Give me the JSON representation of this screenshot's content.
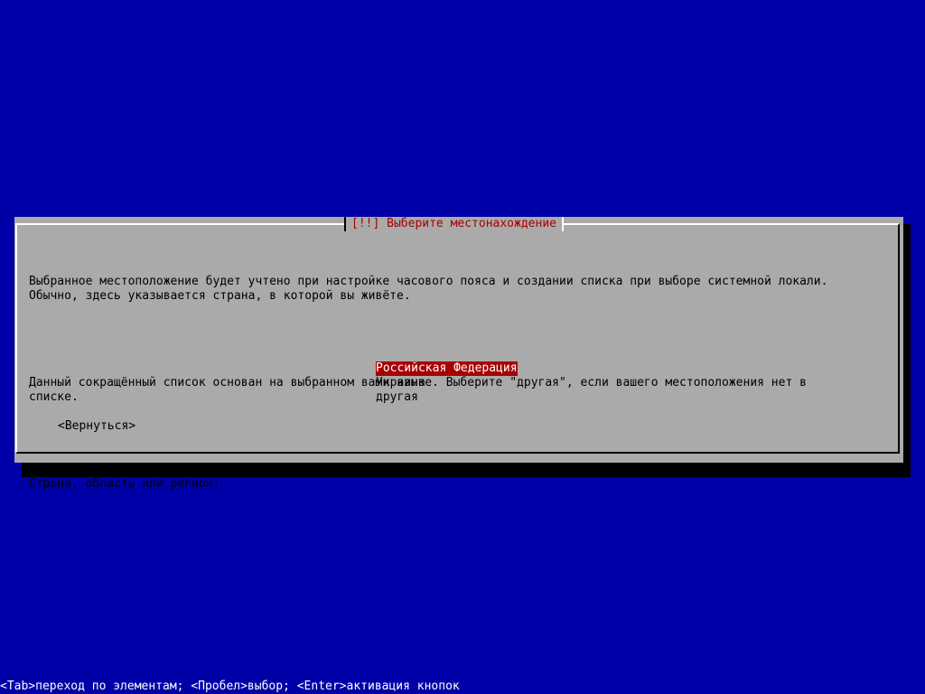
{
  "dialog": {
    "title": "[!!] Выберите местонахождение",
    "paragraph1": "Выбранное местоположение будет учтено при настройке часового пояса и создании списка при выборе системной локали.\nОбычно, здесь указывается страна, в которой вы живёте.",
    "paragraph2": "Данный сокращённый список основан на выбранном вами языке. Выберите \"другая\", если вашего местоположения нет в\nсписке.",
    "prompt": "Страна, область или регион:",
    "options": [
      {
        "label": "Российская Федерация",
        "selected": true
      },
      {
        "label": "Украина",
        "selected": false
      },
      {
        "label": "другая",
        "selected": false
      }
    ],
    "back_label": "<Вернуться>"
  },
  "help_bar": {
    "text": "<Tab>переход по элементам; <Пробел>выбор; <Enter>активация кнопок"
  },
  "colors": {
    "background": "#0000a8",
    "dialog": "#aaaaaa",
    "accent": "#a80000",
    "text": "#000000",
    "help_text": "#ffffff"
  }
}
